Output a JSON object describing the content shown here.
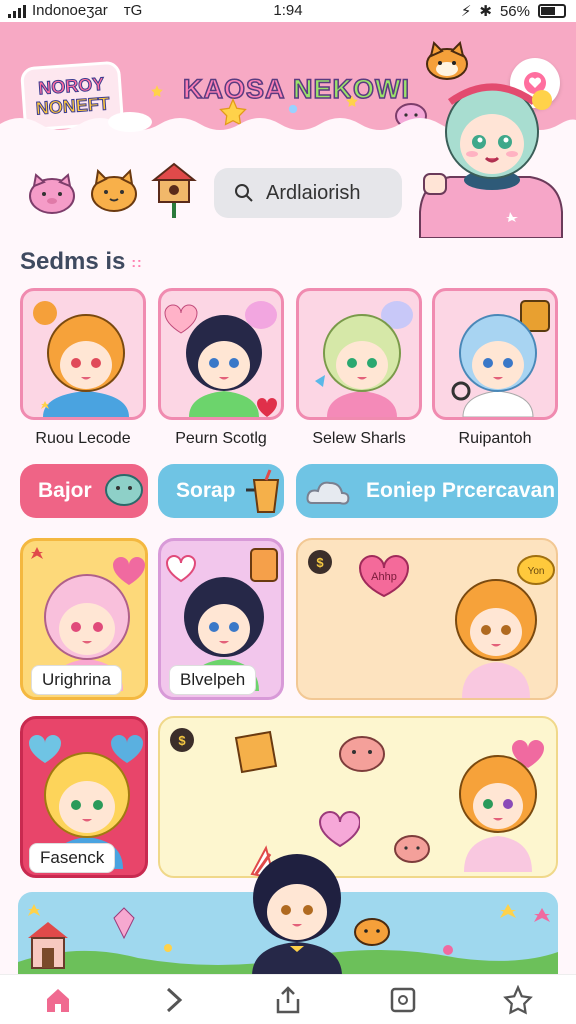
{
  "status_bar": {
    "carrier": "Indonoeӡar",
    "network": "ᴛG",
    "time": "1:94",
    "battery": "56%"
  },
  "header": {
    "logo_line1": "NOROY",
    "logo_line2": "NONEFT",
    "title_part1": "KAOSA",
    "title_part2": "NEKOWI",
    "favorite_icon": "heart-icon"
  },
  "search": {
    "value": "Ardlaiorish",
    "icon": "search-icon"
  },
  "section": {
    "title": "Sedms is",
    "dots": "::"
  },
  "characters": [
    {
      "name": "Ruou Lecode",
      "hair": "#f6a23a",
      "bg": "#fcd6e4"
    },
    {
      "name": "Peurn Scotlg",
      "hair": "#262848",
      "bg": "#fcd6e4"
    },
    {
      "name": "Selew Sharls",
      "hair": "#d6e8a8",
      "bg": "#fcd6e4"
    },
    {
      "name": "Ruipantoh",
      "hair": "#a8d4f2",
      "bg": "#fcd6e4"
    }
  ],
  "pills": [
    {
      "label": "Bajor",
      "color": "#ef6486"
    },
    {
      "label": "Sorap",
      "color": "#6fc4e4"
    },
    {
      "label": "Eoniep Prcercavan",
      "color": "#6fc4e4"
    }
  ],
  "tiles": [
    {
      "label": "Urighrina"
    },
    {
      "label": "Blvelpeh"
    },
    {
      "label": "Fasenck"
    }
  ],
  "speech_bubble": "Ahhp",
  "small_bubble": "Yon",
  "nav": [
    {
      "icon": "home-icon"
    },
    {
      "icon": "chevron-right-icon"
    },
    {
      "icon": "share-icon"
    },
    {
      "icon": "square-icon"
    },
    {
      "icon": "star-icon"
    }
  ]
}
